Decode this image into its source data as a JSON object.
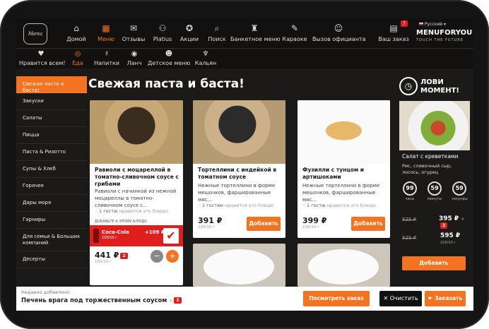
{
  "header": {
    "logo_text": "Menu",
    "nav": [
      {
        "label": "Домой",
        "icon": "home-icon",
        "glyph": "⌂"
      },
      {
        "label": "Меню",
        "icon": "menu-book-icon",
        "glyph": "▦"
      },
      {
        "label": "Отзывы",
        "icon": "reviews-icon",
        "glyph": "✉"
      },
      {
        "label": "Platius",
        "icon": "platius-icon",
        "glyph": "⚇"
      },
      {
        "label": "Акции",
        "icon": "gift-icon",
        "glyph": "✪"
      },
      {
        "label": "Поиск",
        "icon": "search-icon",
        "glyph": "⌕"
      },
      {
        "label": "Банкетное меню",
        "icon": "banquet-icon",
        "glyph": "♜"
      },
      {
        "label": "Караоке",
        "icon": "microphone-icon",
        "glyph": "✎"
      },
      {
        "label": "Вызов официанта",
        "icon": "waiter-icon",
        "glyph": "☺"
      },
      {
        "label": "Ваш заказ",
        "icon": "order-icon",
        "glyph": "▤"
      }
    ],
    "cart_count": "7",
    "language": "Русский",
    "brand": "MENUFORYOU",
    "brand_tagline": "TOUCH THE FUTURE"
  },
  "subnav": [
    {
      "label": "Нравится всем!",
      "icon": "heart-icon",
      "glyph": "♥"
    },
    {
      "label": "Еда",
      "icon": "food-icon",
      "glyph": "◎"
    },
    {
      "label": "Напитки",
      "icon": "drinks-icon",
      "glyph": "♯"
    },
    {
      "label": "Ланч",
      "icon": "lunch-icon",
      "glyph": "◉"
    },
    {
      "label": "Детское меню",
      "icon": "kids-icon",
      "glyph": "☻"
    },
    {
      "label": "Кальян",
      "icon": "hookah-icon",
      "glyph": "♆"
    }
  ],
  "sidebar": [
    {
      "label": "Свежая паста и баста!"
    },
    {
      "label": "Закуски"
    },
    {
      "label": "Салаты"
    },
    {
      "label": "Пицца"
    },
    {
      "label": "Паста & Ризотто"
    },
    {
      "label": "Супы & Хлеб"
    },
    {
      "label": "Горячее"
    },
    {
      "label": "Дары моря"
    },
    {
      "label": "Гарниры"
    },
    {
      "label": "Для семьи & Больших компаний"
    },
    {
      "label": "Десерты"
    }
  ],
  "section_title": "Свежая паста и баста!",
  "cards": [
    {
      "title": "Равиоли с моцареллой в томатно-сливочном соусе с грибами",
      "desc": "Равиоли с начинкой из нежной моцареллы в томатно-сливочном соусе с...",
      "likes_count": "1 гостю",
      "likes_text": "нравится это блюдо",
      "upsell_label": "ДОБАВЬТЕ К ЭТОМУ БЛЮДУ:",
      "upsell_name": "Coca-Cola",
      "upsell_volume": "100/10 г",
      "upsell_price": "+109 ₽",
      "price": "441 ₽",
      "weight": "100/10 г",
      "qty": "2",
      "minus": "−",
      "plus": "+"
    },
    {
      "title": "Тортеллини с индейкой в томатном соусе",
      "desc": "Нежные тортеллини в форме мешочков, фаршированные мяс...",
      "likes_count": "2 гостям",
      "likes_text": "нравится это блюдо",
      "price": "391 ₽",
      "weight": "100/10 г",
      "add": "Добавить"
    },
    {
      "title": "Фузилли с тунцом и артишоками",
      "desc": "Нежные тортеллини в форме мешочков, фаршированные мяс...",
      "likes_count": "1 гостю",
      "likes_text": "нравится это блюдо",
      "price": "399 ₽",
      "weight": "100/10 г",
      "add": "Добавить"
    }
  ],
  "promo": {
    "title": "ЛОВИ МОМЕНТ!",
    "dish": "Салат с креветками",
    "desc": "Рис, сливочный сыр, лосось, огурец",
    "timer": [
      {
        "value": "99",
        "unit": "часы"
      },
      {
        "value": "59",
        "unit": "минуты"
      },
      {
        "value": "59",
        "unit": "секунды"
      }
    ],
    "old_price": "525 ₽",
    "new_price": "395 ₽",
    "qty": "2",
    "old_price2": "525 ₽",
    "new_price2": "595 ₽",
    "weight": "100/10 г",
    "add": "Добавить"
  },
  "bottom": {
    "recent_label": "Недавно добавлено:",
    "recent_item": "Печень врага под торжественным соусом",
    "recent_qty": "2",
    "view_order": "Посмотреть заказ",
    "clear": "Очистить",
    "order": "Заказать"
  },
  "colors": {
    "accent": "#f47320",
    "badge": "#e01e1e",
    "dark": "#121110"
  }
}
